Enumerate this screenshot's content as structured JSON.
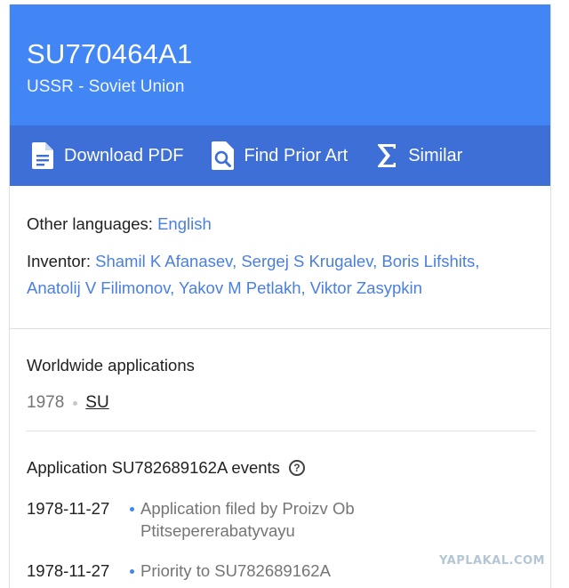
{
  "header": {
    "publication_number": "SU770464A1",
    "country": "USSR - Soviet Union"
  },
  "actions": [
    {
      "label": "Download PDF",
      "icon": "pdf-document-icon"
    },
    {
      "label": "Find Prior Art",
      "icon": "search-document-icon"
    },
    {
      "label": "Similar",
      "icon": "sigma-icon"
    }
  ],
  "other_languages": {
    "label": "Other languages:",
    "value": "English"
  },
  "inventor": {
    "label": "Inventor:",
    "names": [
      "Shamil K Afanasev",
      "Sergej S Krugalev",
      "Boris Lifshits",
      "Anatolij V Filimonov",
      "Yakov M Petlakh",
      "Viktor Zasypkin"
    ],
    "separator": ", "
  },
  "worldwide": {
    "title": "Worldwide applications",
    "year": "1978",
    "country": "SU"
  },
  "events": {
    "title": "Application SU782689162A events",
    "help_glyph": "?",
    "items": [
      {
        "date": "1978-11-27",
        "description": "Application filed by Proizv Ob Ptitsepererabatyvayu"
      },
      {
        "date": "1978-11-27",
        "description": "Priority to SU782689162A"
      }
    ]
  },
  "watermark": "YAPLAKAL.COM",
  "colors": {
    "header_bg": "#4285f4",
    "actionbar_bg": "#3e6fd6",
    "link": "#4a7fe0"
  }
}
